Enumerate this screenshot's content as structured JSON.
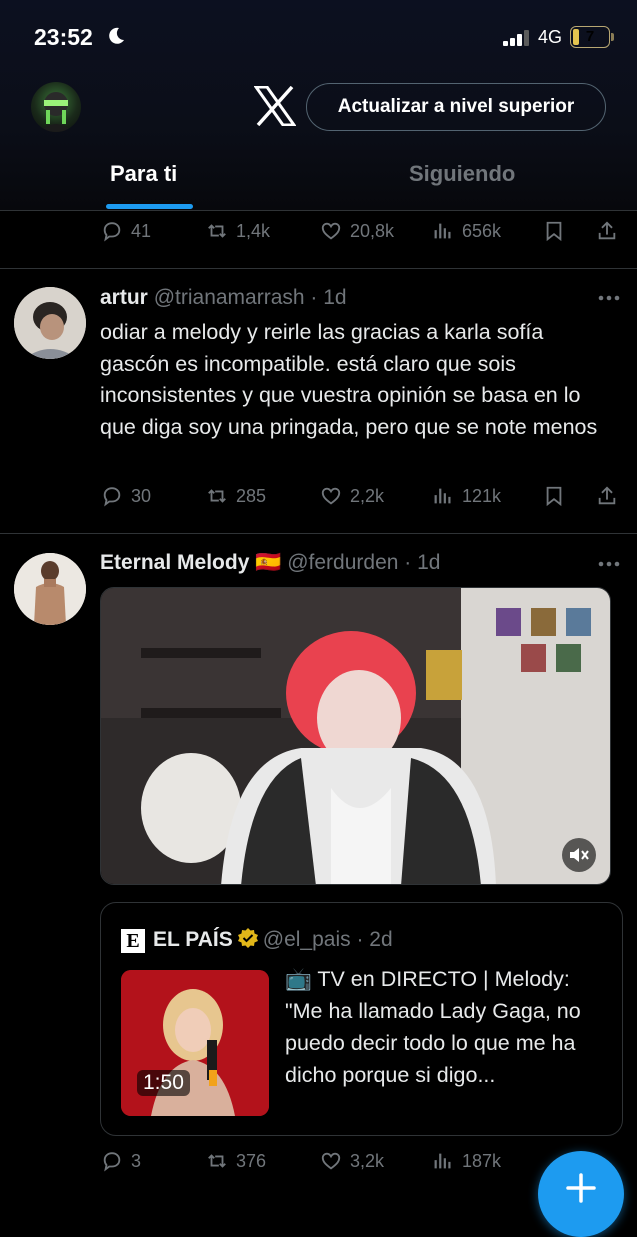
{
  "status_bar": {
    "time": "23:52",
    "network": "4G",
    "battery": "7"
  },
  "header": {
    "upgrade_label": "Actualizar a nivel superior"
  },
  "tabs": [
    {
      "label": "Para ti",
      "active": true
    },
    {
      "label": "Siguiendo",
      "active": false
    }
  ],
  "top_actions": {
    "replies": "41",
    "reposts": "1,4k",
    "likes": "20,8k",
    "views": "656k"
  },
  "tweets": [
    {
      "name": "artur",
      "handle": "@trianamarrash",
      "time": "· 1d",
      "text": "odiar a melody y reirle las gracias a karla sofía gascón es incompatible. está claro que sois inconsistentes y que vuestra opinión se basa en lo que diga soy una pringada, pero que se note menos",
      "replies": "30",
      "reposts": "285",
      "likes": "2,2k",
      "views": "121k"
    },
    {
      "name": "Eternal Melody",
      "flag": "🇪🇸",
      "handle": "@ferdurden",
      "time": "· 1d",
      "replies": "3",
      "reposts": "376",
      "likes": "3,2k",
      "views": "187k",
      "quote": {
        "logo": "E",
        "name": "EL PAÍS",
        "handle": "@el_pais",
        "time": "· 2d",
        "text": "📺 TV en DIRECTO | Melody: \"Me ha llamado Lady Gaga, no puedo decir todo lo que me ha dicho porque si digo...",
        "duration": "1:50"
      }
    }
  ],
  "colors": {
    "accent": "#1d9bf0",
    "muted": "#71767b",
    "border": "#2f3336",
    "text": "#e7e9ea"
  },
  "icons": [
    "moon-icon",
    "signal-icon",
    "battery-icon",
    "x-logo-icon",
    "reply-icon",
    "repost-icon",
    "like-icon",
    "views-icon",
    "bookmark-icon",
    "share-icon",
    "more-icon",
    "verified-icon",
    "mute-icon",
    "compose-icon"
  ]
}
